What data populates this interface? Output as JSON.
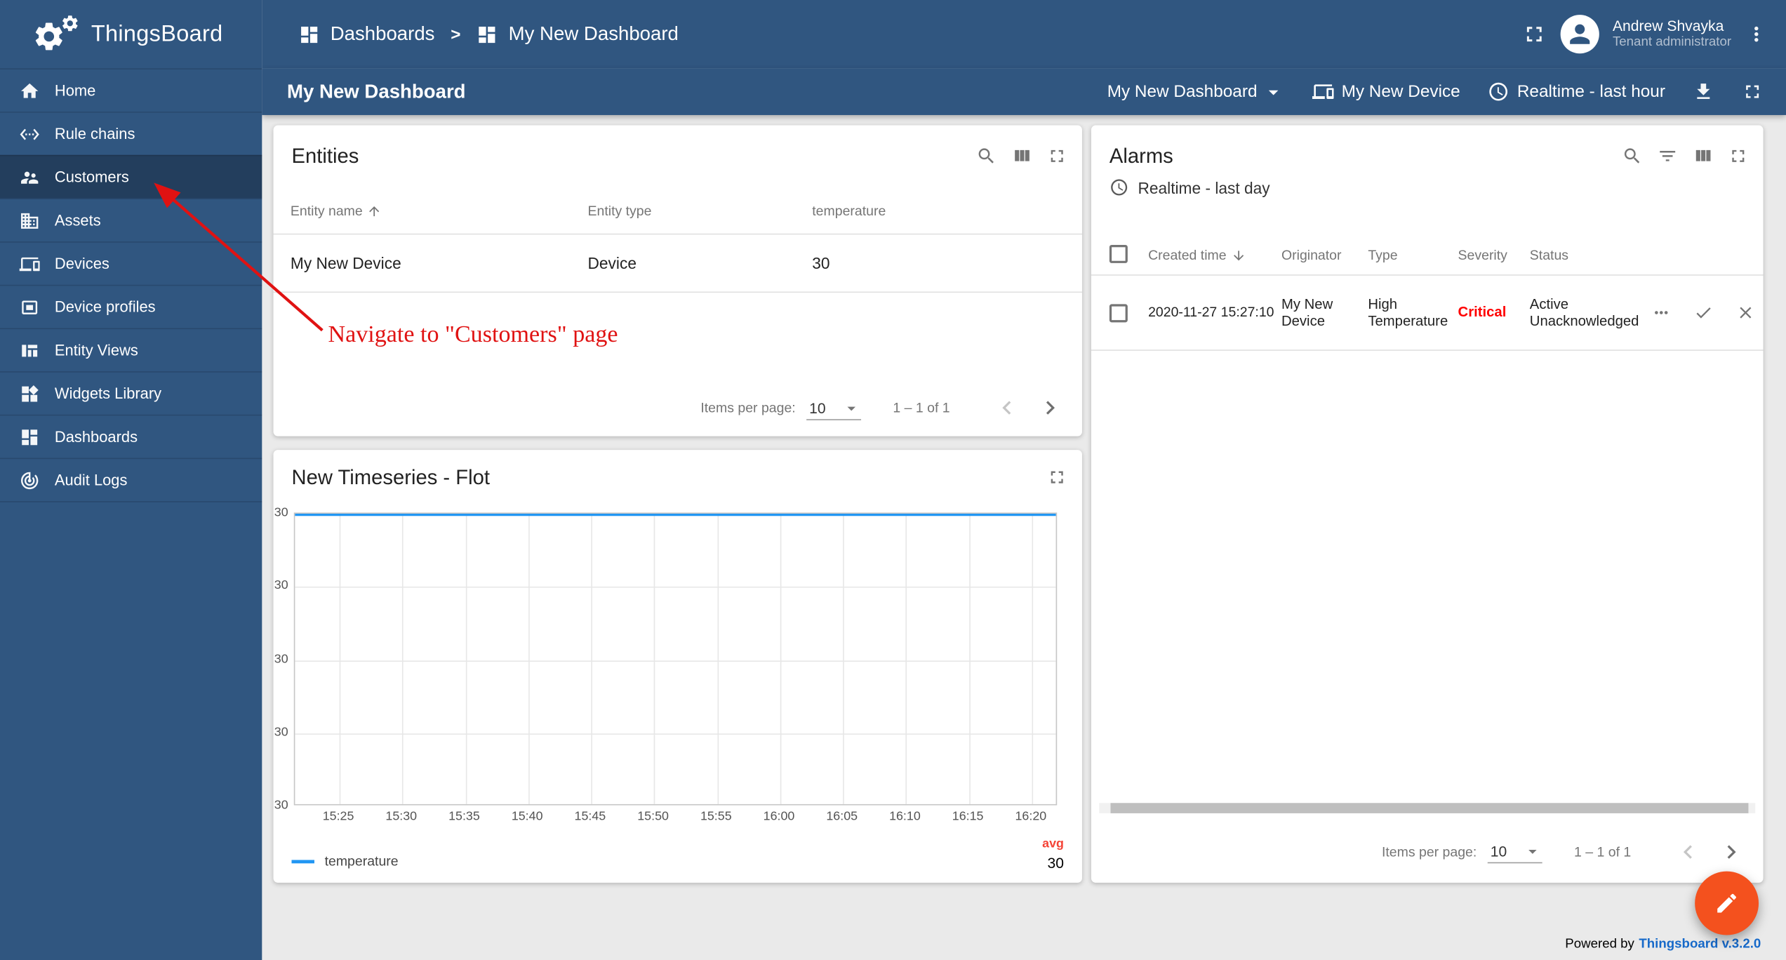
{
  "app": {
    "name": "ThingsBoard"
  },
  "topbar": {
    "breadcrumb": {
      "items": [
        {
          "label": "Dashboards"
        },
        {
          "label": "My New Dashboard"
        }
      ],
      "separator": ">"
    },
    "user": {
      "name": "Andrew Shvayka",
      "role": "Tenant administrator"
    }
  },
  "dashboard_toolbar": {
    "title": "My New Dashboard",
    "state_select": "My New Dashboard",
    "device_entity": "My New Device",
    "timewindow": "Realtime - last hour"
  },
  "sidebar": {
    "items": [
      {
        "label": "Home",
        "active": false
      },
      {
        "label": "Rule chains",
        "active": false
      },
      {
        "label": "Customers",
        "active": true
      },
      {
        "label": "Assets",
        "active": false
      },
      {
        "label": "Devices",
        "active": false
      },
      {
        "label": "Device profiles",
        "active": false
      },
      {
        "label": "Entity Views",
        "active": false
      },
      {
        "label": "Widgets Library",
        "active": false
      },
      {
        "label": "Dashboards",
        "active": false
      },
      {
        "label": "Audit Logs",
        "active": false
      }
    ]
  },
  "entities_widget": {
    "title": "Entities",
    "columns": {
      "name": "Entity name",
      "type": "Entity type",
      "temperature": "temperature"
    },
    "rows": [
      {
        "name": "My New Device",
        "type": "Device",
        "temperature": "30"
      }
    ],
    "paginator": {
      "label": "Items per page:",
      "page_size": "10",
      "range": "1 – 1 of 1"
    }
  },
  "annotation": {
    "text": "Navigate to \"Customers\" page"
  },
  "timeseries_widget": {
    "title": "New Timeseries - Flot",
    "legend": {
      "series_label": "temperature",
      "agg_label": "avg",
      "agg_value": "30"
    },
    "chart_data": {
      "type": "line",
      "title": "New Timeseries - Flot",
      "x_ticks": [
        "15:25",
        "15:30",
        "15:35",
        "15:40",
        "15:45",
        "15:50",
        "15:55",
        "16:00",
        "16:05",
        "16:10",
        "16:15",
        "16:20"
      ],
      "y_ticks": [
        "30",
        "30",
        "30",
        "30",
        "30"
      ],
      "series": [
        {
          "name": "temperature",
          "color": "#2196f3",
          "aggregation": "avg",
          "values": [
            30,
            30,
            30,
            30,
            30,
            30,
            30,
            30,
            30,
            30,
            30,
            30
          ],
          "latest": 30
        }
      ],
      "ylim": [
        30,
        30
      ],
      "grid": true,
      "legend_position": "bottom"
    }
  },
  "alarms_widget": {
    "title": "Alarms",
    "timewindow": "Realtime - last day",
    "columns": {
      "created": "Created time",
      "originator": "Originator",
      "type": "Type",
      "severity": "Severity",
      "status": "Status"
    },
    "rows": [
      {
        "created": "2020-11-27 15:27:10",
        "originator": "My New Device",
        "type": "High Temperature",
        "severity": "Critical",
        "status": "Active Unacknowledged"
      }
    ],
    "paginator": {
      "label": "Items per page:",
      "page_size": "10",
      "range": "1 – 1 of 1"
    }
  },
  "footer": {
    "powered_by": "Powered by",
    "link": "Thingsboard v.3.2.0"
  },
  "colors": {
    "primary": "#305680",
    "content_bg": "#eaeaea",
    "series_blue": "#2196f3",
    "critical_red": "#ff0000",
    "agg_red": "#f44336",
    "fab_orange": "#f4511e",
    "annotation_red": "#e01212",
    "link_blue": "#1669c9"
  }
}
